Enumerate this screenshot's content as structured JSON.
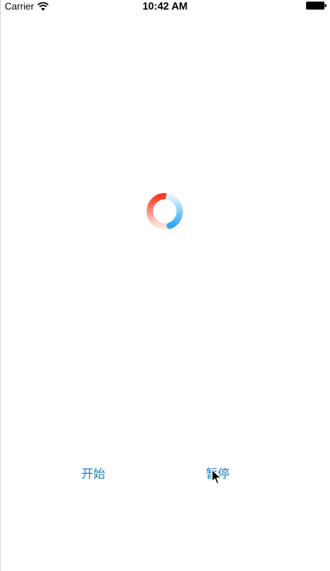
{
  "status_bar": {
    "carrier": "Carrier",
    "time": "10:42 AM",
    "icons": [
      "wifi-icon",
      "battery-icon"
    ]
  },
  "spinner": {
    "icon": "loading-ring-icon",
    "colors": {
      "left_arc": "#f03c1e",
      "right_arc": "#2aa8f0"
    }
  },
  "controls": {
    "start_label": "开始",
    "pause_label": "暂停",
    "link_color": "#1a7fc8"
  },
  "pointer": {
    "icon": "mouse-cursor-icon"
  }
}
